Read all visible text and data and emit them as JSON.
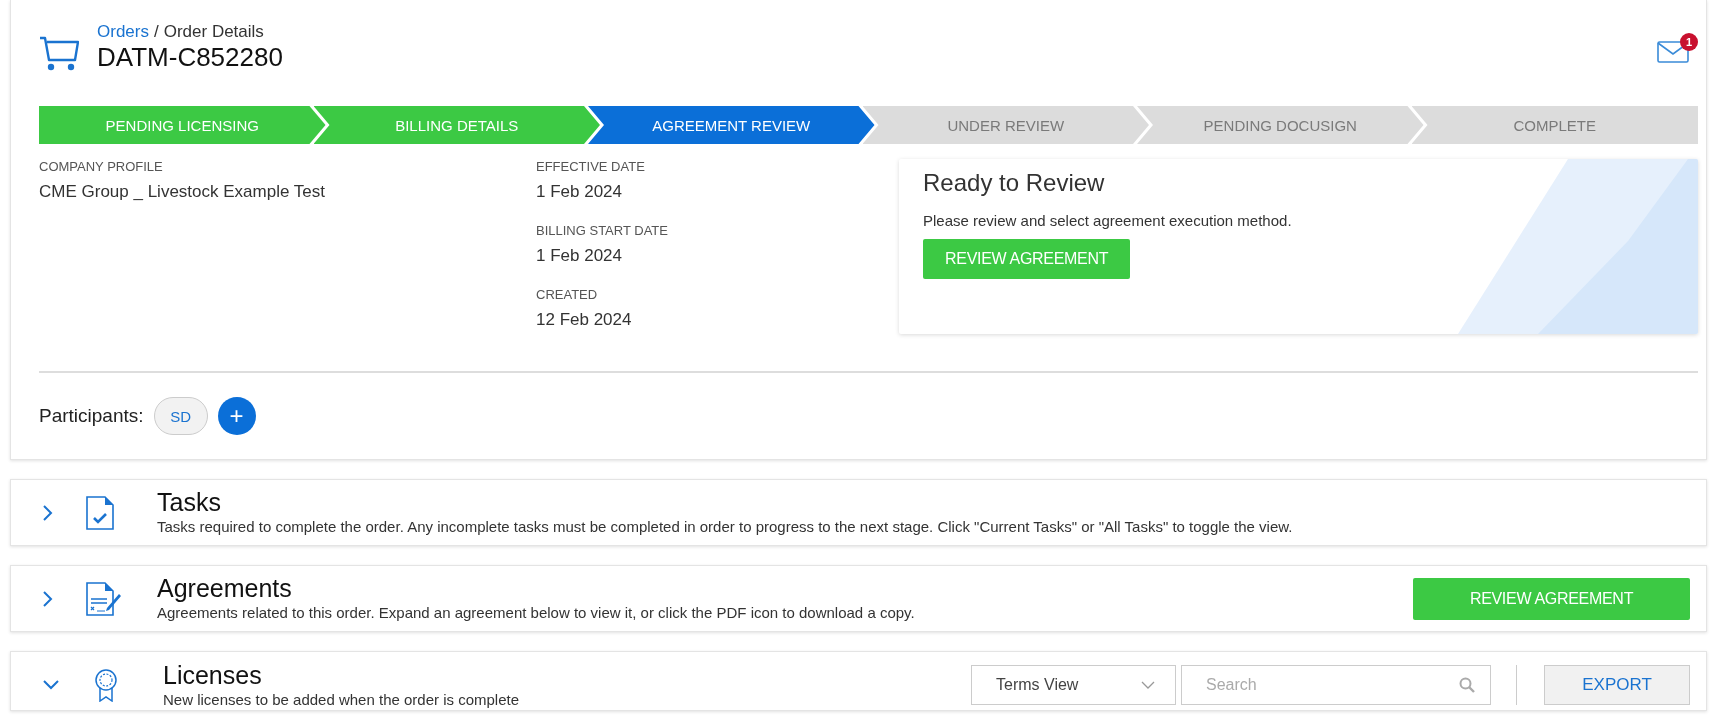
{
  "header": {
    "breadcrumb": {
      "link": "Orders",
      "separator": "/",
      "current": "Order Details"
    },
    "order_id": "DATM-C852280",
    "notifications": {
      "count": "1"
    }
  },
  "steps": [
    {
      "label": "PENDING LICENSING",
      "completed": true,
      "selected": false
    },
    {
      "label": "BILLING DETAILS",
      "completed": true,
      "selected": false
    },
    {
      "label": "AGREEMENT REVIEW",
      "completed": false,
      "selected": true
    },
    {
      "label": "UNDER REVIEW",
      "completed": false,
      "selected": false
    },
    {
      "label": "PENDING DOCUSIGN",
      "completed": false,
      "selected": false
    },
    {
      "label": "COMPLETE",
      "completed": false,
      "selected": false
    }
  ],
  "details": {
    "company": {
      "label": "COMPANY PROFILE",
      "value": "CME Group _ Livestock Example Test"
    },
    "dates": [
      {
        "label": "EFFECTIVE DATE",
        "value": "1 Feb 2024"
      },
      {
        "label": "BILLING START DATE",
        "value": "1 Feb 2024"
      },
      {
        "label": "CREATED",
        "value": "12 Feb 2024"
      }
    ]
  },
  "status_card": {
    "title": "Ready to Review",
    "message": "Please review and select agreement execution method.",
    "button": "REVIEW AGREEMENT"
  },
  "participants": {
    "label": "Participants:",
    "people": [
      {
        "initials": "SD"
      }
    ],
    "add_button": "+"
  },
  "sections": [
    {
      "kind": "tasks",
      "title": "Tasks",
      "description": "Tasks required to complete the order. Any incomplete tasks must be completed in order to progress to the next stage. Click \"Current Tasks\" or \"All Tasks\" to toggle the view.",
      "expanded": false
    },
    {
      "kind": "agreements",
      "title": "Agreements",
      "description": "Agreements related to this order. Expand an agreement below to view it, or click the PDF icon to download a copy.",
      "expanded": false,
      "button": "REVIEW AGREEMENT"
    },
    {
      "kind": "licenses",
      "title": "Licenses",
      "description": "New licenses to be added when the order is complete",
      "expanded": true,
      "view_select": "Terms View",
      "search_placeholder": "Search",
      "export_button": "EXPORT"
    }
  ]
}
